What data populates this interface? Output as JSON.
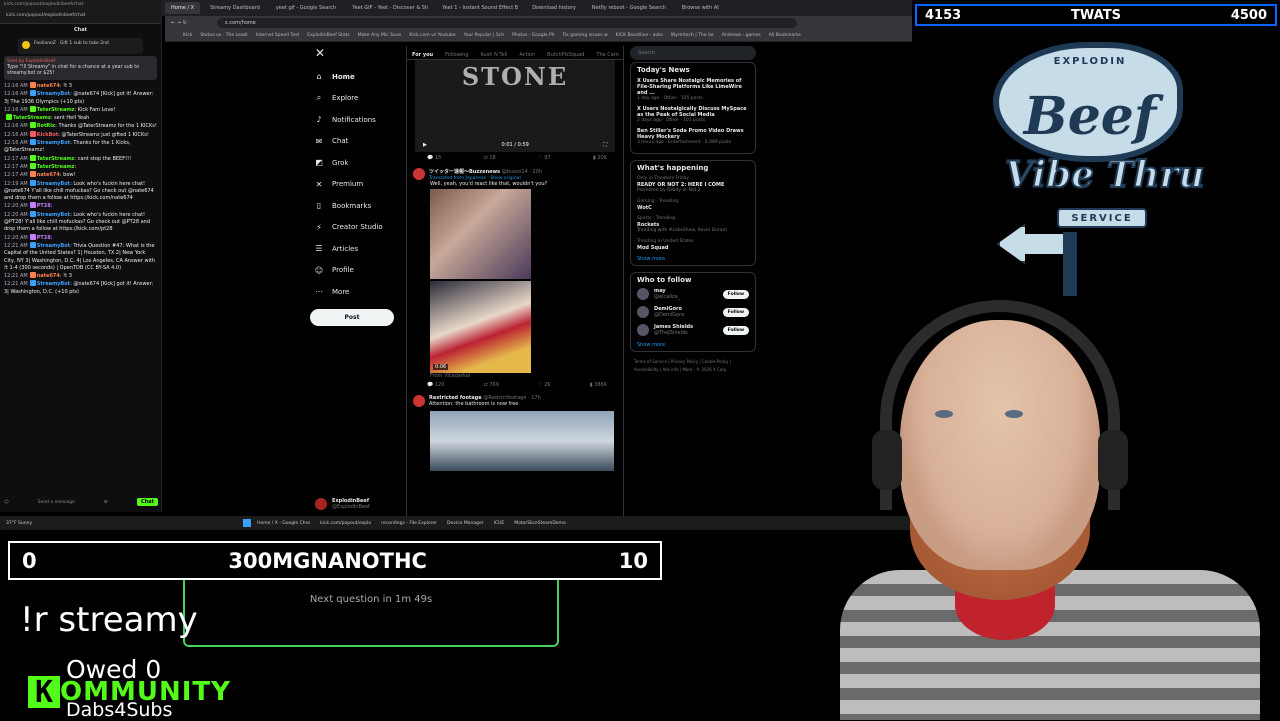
{
  "browser": {
    "tabs": [
      "Home / X",
      "Streamy Dashboard",
      "yeet gif - Google Search",
      "Yeet GIF - Yeet - Discover & Sh",
      "Yeet 1 - Instant Sound Effect B",
      "Download history",
      "Netfly reboot - Google Search",
      "Browse with AI"
    ],
    "url": "x.com/home",
    "bookmarks": [
      "Kick",
      "Status.us - The Leadi",
      "Internet Speed Test",
      "ExplodinBeef Stats",
      "Make Any Mic Soun",
      "Kick.com vs Youtube",
      "Your Popular | Sch",
      "Photos - Google Ph",
      "Fix gaming issues w",
      "KICK Boostlive - auto",
      "Wyrmtech | The lar",
      "Andrews - games",
      "All Bookmarks"
    ]
  },
  "chat": {
    "url": "kick.com/popout/explodinbeef/chat",
    "title": "Chat",
    "pinned": {
      "user": "FoolianoZ",
      "text": "Gift 1 sub to take 2nd"
    },
    "promo": {
      "header": "Sent by ExplodinBeef",
      "text": "Type \"!ll Streamy\" in chat for a chance at a year sub to streamy.bot or $25!"
    },
    "messages": [
      {
        "time": "12:16 AM",
        "user": "nate674",
        "color": "#ff7f50",
        "text": "!t 3"
      },
      {
        "time": "12:16 AM",
        "user": "StreamyBot",
        "color": "#3aa0ff",
        "text": "@nate674 [Kick] got it! Answer: 3| The 1936 Olympics (+10 pts)"
      },
      {
        "time": "12:16 AM",
        "user": "TaterStreamz",
        "color": "#53fc18",
        "text": "Kick Fam Love!"
      },
      {
        "time": "",
        "user": "TaterStreamz",
        "color": "#53fc18",
        "text": "sent Hell Yeah"
      },
      {
        "time": "12:16 AM",
        "user": "BotRix",
        "color": "#53fc18",
        "text": "Thanks @TaterStreamz for the 1 KICKs!"
      },
      {
        "time": "12:16 AM",
        "user": "KickBot",
        "color": "#f25c5c",
        "text": "@TaterStreamz just gifted 1 KICKs!"
      },
      {
        "time": "12:16 AM",
        "user": "StreamyBot",
        "color": "#3aa0ff",
        "text": "Thanks for the 1 Kicks, @TaterStreamz!"
      },
      {
        "time": "12:17 AM",
        "user": "TaterStreamz",
        "color": "#53fc18",
        "text": "cant stop the BEEF!!!"
      },
      {
        "time": "12:17 AM",
        "user": "TaterStreamz",
        "color": "#53fc18",
        "text": ""
      },
      {
        "time": "12:17 AM",
        "user": "nate674",
        "color": "#ff7f50",
        "text": "bow!"
      },
      {
        "time": "12:19 AM",
        "user": "StreamyBot",
        "color": "#3aa0ff",
        "text": "Look who's fuckin here chat! @nate674 Y'all like chill mofuckas? Go check out @nate674 and drop them a follow at https://kick.com/nate674"
      },
      {
        "time": "12:20 AM",
        "user": "PT28",
        "color": "#c77dff",
        "text": ""
      },
      {
        "time": "12:20 AM",
        "user": "StreamyBot",
        "color": "#3aa0ff",
        "text": "Look who's fuckin here chat! @PT28! Y'all like chill mofuckas? Go check out @PT28 and drop them a follow at https://kick.com/pt28"
      },
      {
        "time": "12:20 AM",
        "user": "PT28",
        "color": "#c77dff",
        "text": ""
      },
      {
        "time": "12:21 AM",
        "user": "StreamyBot",
        "color": "#3aa0ff",
        "text": "Trivia Question #47: What is the Capital of the United States? 1| Houston, TX 2| New York City, NY 3| Washington, D.C. 4| Los Angeles, CA Answer with !t 1-4 (300 seconds) | OpenTDB (CC BY-SA 4.0)"
      },
      {
        "time": "12:21 AM",
        "user": "nate674",
        "color": "#ff7f50",
        "text": "!t 3"
      },
      {
        "time": "12:21 AM",
        "user": "StreamyBot",
        "color": "#3aa0ff",
        "text": "@nate674 [Kick] got it! Answer: 3| Washington, D.C. (+10 pts)"
      }
    ],
    "input_placeholder": "Send a message",
    "send_label": "Chat"
  },
  "x": {
    "nav": [
      {
        "label": "Home",
        "icon": "home-icon",
        "glyph": "⌂"
      },
      {
        "label": "Explore",
        "icon": "search-icon",
        "glyph": "⌕"
      },
      {
        "label": "Notifications",
        "icon": "bell-icon",
        "glyph": "♪"
      },
      {
        "label": "Chat",
        "icon": "chat-icon",
        "glyph": "✉"
      },
      {
        "label": "Grok",
        "icon": "grok-icon",
        "glyph": "◩"
      },
      {
        "label": "Premium",
        "icon": "premium-icon",
        "glyph": "✕"
      },
      {
        "label": "Bookmarks",
        "icon": "bookmark-icon",
        "glyph": "▯"
      },
      {
        "label": "Creator Studio",
        "icon": "creator-icon",
        "glyph": "⚡"
      },
      {
        "label": "Articles",
        "icon": "article-icon",
        "glyph": "☰"
      },
      {
        "label": "Profile",
        "icon": "profile-icon",
        "glyph": "☺"
      },
      {
        "label": "More",
        "icon": "more-icon",
        "glyph": "⋯"
      }
    ],
    "post_label": "Post",
    "profile": {
      "name": "ExplodinBeef",
      "handle": "@ExplodinBeef"
    },
    "feed_tabs": [
      "For you",
      "Following",
      "Kush N Tell",
      "Action",
      "ButchPlsSquad",
      "The Cam"
    ],
    "video": {
      "title": "STONE",
      "time": "0:01 / 0:59",
      "actions": [
        "16",
        "18",
        "97",
        "20K"
      ]
    },
    "tweet1": {
      "name": "ツイッター速報～Buzzenews",
      "handle": "@buzzo14 · 20h",
      "sub": "Translated from Japanese · Show original",
      "text": "Well, yeah, you'd react like that, wouldn't you?",
      "duration": "0:06",
      "quote": "From Vlcadarkal",
      "actions": [
        "120",
        "769",
        "2K",
        "386K"
      ]
    },
    "tweet2": {
      "name": "Restricted footage",
      "handle": "@Restrictfootage · 17h",
      "text": "Attention: the bathroom is now free"
    },
    "search_placeholder": "Search",
    "news_title": "Today's News",
    "news": [
      {
        "title": "X Users Share Nostalgic Memories of File-Sharing Platforms Like LimeWire and ...",
        "meta": "1 day ago · Other · 105 posts"
      },
      {
        "title": "X Users Nostalgically Discuss MySpace as the Peak of Social Media",
        "meta": "2 days ago · Other · 101 posts"
      },
      {
        "title": "Ben Stiller's Soda Promo Video Draws Heavy Mockery",
        "meta": "3 hours ago · Entertainment · 2,089 posts"
      }
    ],
    "happening_title": "What's happening",
    "trends": [
      {
        "small": "Only in Theaters Friday",
        "name": "READY OR NOT 2: HERE I COME",
        "extra": "Promoted by Ready or Not 2"
      },
      {
        "small": "Gaming · Trending",
        "name": "WotC",
        "extra": ""
      },
      {
        "small": "Sports · Trending",
        "name": "Rockets",
        "extra": "Trending with #LakeShow, Kevin Durant"
      },
      {
        "small": "Trending in United States",
        "name": "Mod Squad",
        "extra": ""
      }
    ],
    "show_more": "Show more",
    "wtf_title": "Who to follow",
    "follow": [
      {
        "name": "may",
        "handle": "@elcaliza_"
      },
      {
        "name": "DemiGoro",
        "handle": "@DemiGoro"
      },
      {
        "name": "James Shields",
        "handle": "@TheJShields"
      }
    ],
    "follow_label": "Follow",
    "footer": "Terms of Service | Privacy Policy | Cookie Policy | Accessibility | Ads info | More · © 2026 X Corp."
  },
  "taskbar": {
    "weather": "37°F Sunny",
    "items": [
      "Home / X - Google Chro",
      "kick.com/popout/explo",
      "recordings - File Explorer",
      "Device Manager",
      "ICUE",
      "MotorSliceSteamDemo"
    ]
  },
  "overlay": {
    "score_left": "4153",
    "score_title": "TWATS",
    "score_right": "4500",
    "logo_top": "EXPLODIN",
    "logo_main": "Beef",
    "logo_vibe": "Vibe Thru",
    "logo_service": "SERVICE",
    "trivia_left": "0",
    "trivia_title": "300MGNANOTHC",
    "trivia_right": "10",
    "next_question": "Next question in 1m 49s",
    "command": "!r streamy",
    "owed": "Owed 0",
    "kommunity_k": "K",
    "kommunity_text": "OMMUNITY",
    "dabs": "Dabs4Subs"
  },
  "colors": {
    "kick_green": "#53fc18",
    "x_blue": "#1d9bf0",
    "score_border": "#0a64ff"
  }
}
